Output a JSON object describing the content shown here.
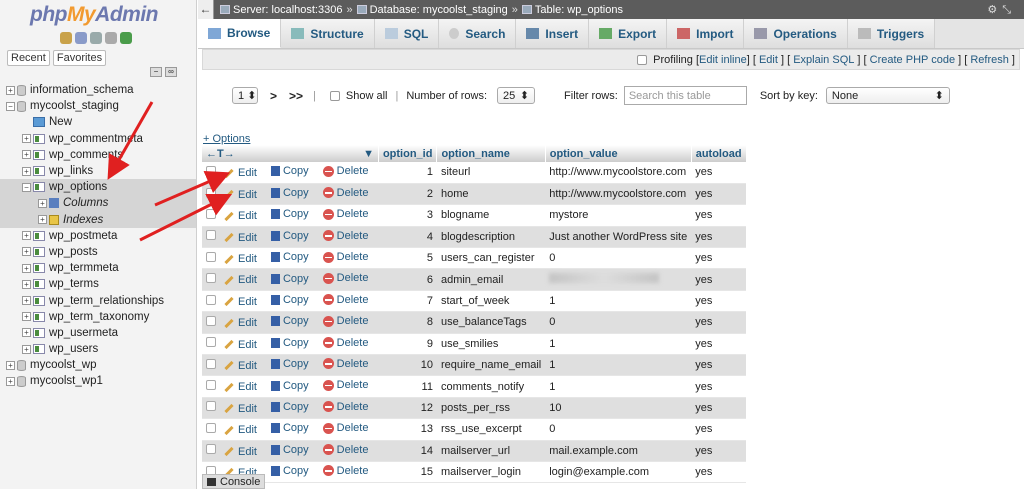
{
  "app": {
    "logo_php": "php",
    "logo_my": "My",
    "logo_admin": "Admin"
  },
  "sidebar": {
    "tab_recent": "Recent",
    "tab_favorites": "Favorites",
    "tree": [
      {
        "label": "information_schema",
        "kind": "db",
        "toggle": "+"
      },
      {
        "label": "mycoolst_staging",
        "kind": "db",
        "toggle": "−"
      },
      {
        "label": "New",
        "kind": "new"
      },
      {
        "label": "wp_commentmeta",
        "kind": "table",
        "toggle": "+"
      },
      {
        "label": "wp_comments",
        "kind": "table",
        "toggle": "+"
      },
      {
        "label": "wp_links",
        "kind": "table",
        "toggle": "+"
      },
      {
        "label": "wp_options",
        "kind": "table",
        "toggle": "−"
      },
      {
        "label": "Columns",
        "kind": "columns",
        "toggle": "+"
      },
      {
        "label": "Indexes",
        "kind": "indexes",
        "toggle": "+"
      },
      {
        "label": "wp_postmeta",
        "kind": "table",
        "toggle": "+"
      },
      {
        "label": "wp_posts",
        "kind": "table",
        "toggle": "+"
      },
      {
        "label": "wp_termmeta",
        "kind": "table",
        "toggle": "+"
      },
      {
        "label": "wp_terms",
        "kind": "table",
        "toggle": "+"
      },
      {
        "label": "wp_term_relationships",
        "kind": "table",
        "toggle": "+"
      },
      {
        "label": "wp_term_taxonomy",
        "kind": "table",
        "toggle": "+"
      },
      {
        "label": "wp_usermeta",
        "kind": "table",
        "toggle": "+"
      },
      {
        "label": "wp_users",
        "kind": "table",
        "toggle": "+"
      },
      {
        "label": "mycoolst_wp",
        "kind": "db",
        "toggle": "+"
      },
      {
        "label": "mycoolst_wp1",
        "kind": "db",
        "toggle": "+"
      }
    ]
  },
  "breadcrumb": {
    "server": "Server: localhost:3306",
    "database": "Database: mycoolst_staging",
    "table": "Table: wp_options",
    "separator": "»"
  },
  "tabs": [
    "Browse",
    "Structure",
    "SQL",
    "Search",
    "Insert",
    "Export",
    "Import",
    "Operations",
    "Triggers"
  ],
  "profiling": {
    "label": "Profiling",
    "links": [
      "Edit inline",
      "Edit",
      "Explain SQL",
      "Create PHP code",
      "Refresh"
    ]
  },
  "nav": {
    "page": "1",
    "next": ">",
    "last": ">>",
    "divider": "|",
    "show_all": "Show all",
    "rows_label": "Number of rows:",
    "rows_value": "25",
    "filter_label": "Filter rows:",
    "filter_placeholder": "Search this table",
    "sort_label": "Sort by key:",
    "sort_value": "None",
    "select_caret": "▾",
    "page_caret": "⬍"
  },
  "table": {
    "options_link": "+ Options",
    "arrows_header": "←T→",
    "sort_caret": "▼",
    "columns": [
      "option_id",
      "option_name",
      "option_value",
      "autoload"
    ],
    "action_labels": {
      "edit": "Edit",
      "copy": "Copy",
      "delete": "Delete"
    },
    "rows": [
      {
        "id": "1",
        "name": "siteurl",
        "value": "http://www.mycoolstore.com",
        "autoload": "yes"
      },
      {
        "id": "2",
        "name": "home",
        "value": "http://www.mycoolstore.com",
        "autoload": "yes"
      },
      {
        "id": "3",
        "name": "blogname",
        "value": "mystore",
        "autoload": "yes"
      },
      {
        "id": "4",
        "name": "blogdescription",
        "value": "Just another WordPress site",
        "autoload": "yes"
      },
      {
        "id": "5",
        "name": "users_can_register",
        "value": "0",
        "autoload": "yes"
      },
      {
        "id": "6",
        "name": "admin_email",
        "value": "",
        "autoload": "yes"
      },
      {
        "id": "7",
        "name": "start_of_week",
        "value": "1",
        "autoload": "yes"
      },
      {
        "id": "8",
        "name": "use_balanceTags",
        "value": "0",
        "autoload": "yes"
      },
      {
        "id": "9",
        "name": "use_smilies",
        "value": "1",
        "autoload": "yes"
      },
      {
        "id": "10",
        "name": "require_name_email",
        "value": "1",
        "autoload": "yes"
      },
      {
        "id": "11",
        "name": "comments_notify",
        "value": "1",
        "autoload": "yes"
      },
      {
        "id": "12",
        "name": "posts_per_rss",
        "value": "10",
        "autoload": "yes"
      },
      {
        "id": "13",
        "name": "rss_use_excerpt",
        "value": "0",
        "autoload": "yes"
      },
      {
        "id": "14",
        "name": "mailserver_url",
        "value": "mail.example.com",
        "autoload": "yes"
      },
      {
        "id": "15",
        "name": "mailserver_login",
        "value": "login@example.com",
        "autoload": "yes"
      }
    ]
  },
  "console": {
    "label": "Console"
  },
  "colors": {
    "link": "#235a81",
    "arrow": "#e02020",
    "topbar": "#5c5c5c"
  }
}
